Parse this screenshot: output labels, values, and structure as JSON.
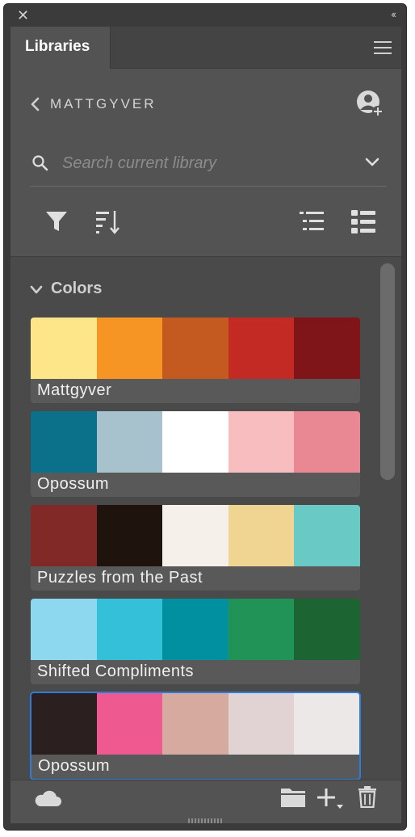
{
  "window": {
    "close_glyph": "✕",
    "collapse_glyph": "‹‹"
  },
  "tab": {
    "label": "Libraries",
    "menu_icon": "hamburger-menu-icon"
  },
  "library": {
    "name": "MATTGYVER",
    "back_icon": "chevron-left-icon",
    "share_icon": "add-person-icon"
  },
  "search": {
    "placeholder": "Search current library",
    "value": "",
    "icon": "search-icon",
    "dropdown_icon": "chevron-down-icon"
  },
  "toolbar": {
    "filter_icon": "filter-icon",
    "sort_icon": "sort-icon",
    "list_view_icon": "list-view-icon",
    "grid_view_icon": "grid-list-view-icon"
  },
  "section": {
    "title": "Colors",
    "expanded": true
  },
  "themes": [
    {
      "name": "Mattgyver",
      "colors": [
        "#FDE58A",
        "#F69524",
        "#C45A20",
        "#C42A24",
        "#7F1518"
      ],
      "selected": false
    },
    {
      "name": "Opossum",
      "colors": [
        "#0B7089",
        "#A8C2CD",
        "#FFFFFF",
        "#F8BDBF",
        "#E98792"
      ],
      "selected": false
    },
    {
      "name": "Puzzles from the Past",
      "colors": [
        "#812927",
        "#1E140D",
        "#F6F0EA",
        "#F0D592",
        "#68C9C5"
      ],
      "selected": false
    },
    {
      "name": "Shifted Compliments",
      "colors": [
        "#8DD7EF",
        "#33C0D8",
        "#01909F",
        "#229356",
        "#1D6433"
      ],
      "selected": false
    },
    {
      "name": "Opossum",
      "colors": [
        "#2C1F1F",
        "#EE5990",
        "#D6AA9F",
        "#E1D3D4",
        "#EDE8E8"
      ],
      "selected": true
    }
  ],
  "bottom": {
    "cloud_icon": "cloud-sync-icon",
    "folder_icon": "folder-icon",
    "add_icon": "add-plus-icon",
    "trash_icon": "trash-icon"
  },
  "colors": {
    "panel_bg": "#535353",
    "content_bg": "#4a4a4a",
    "selection": "#2f7bd9"
  }
}
